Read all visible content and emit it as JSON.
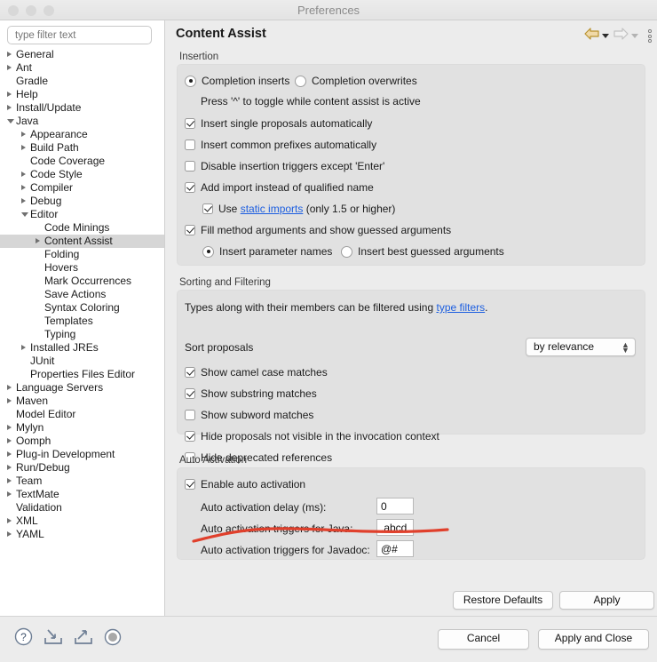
{
  "window": {
    "title": "Preferences"
  },
  "sidebar": {
    "filter_placeholder": "type filter text",
    "items": [
      {
        "label": "General",
        "depth": 0,
        "arrow": "closed"
      },
      {
        "label": "Ant",
        "depth": 0,
        "arrow": "closed"
      },
      {
        "label": "Gradle",
        "depth": 0,
        "arrow": "none"
      },
      {
        "label": "Help",
        "depth": 0,
        "arrow": "closed"
      },
      {
        "label": "Install/Update",
        "depth": 0,
        "arrow": "closed"
      },
      {
        "label": "Java",
        "depth": 0,
        "arrow": "open"
      },
      {
        "label": "Appearance",
        "depth": 1,
        "arrow": "closed"
      },
      {
        "label": "Build Path",
        "depth": 1,
        "arrow": "closed"
      },
      {
        "label": "Code Coverage",
        "depth": 1,
        "arrow": "none"
      },
      {
        "label": "Code Style",
        "depth": 1,
        "arrow": "closed"
      },
      {
        "label": "Compiler",
        "depth": 1,
        "arrow": "closed"
      },
      {
        "label": "Debug",
        "depth": 1,
        "arrow": "closed"
      },
      {
        "label": "Editor",
        "depth": 1,
        "arrow": "open"
      },
      {
        "label": "Code Minings",
        "depth": 2,
        "arrow": "none"
      },
      {
        "label": "Content Assist",
        "depth": 2,
        "arrow": "closed",
        "selected": true
      },
      {
        "label": "Folding",
        "depth": 2,
        "arrow": "none"
      },
      {
        "label": "Hovers",
        "depth": 2,
        "arrow": "none"
      },
      {
        "label": "Mark Occurrences",
        "depth": 2,
        "arrow": "none"
      },
      {
        "label": "Save Actions",
        "depth": 2,
        "arrow": "none"
      },
      {
        "label": "Syntax Coloring",
        "depth": 2,
        "arrow": "none"
      },
      {
        "label": "Templates",
        "depth": 2,
        "arrow": "none"
      },
      {
        "label": "Typing",
        "depth": 2,
        "arrow": "none"
      },
      {
        "label": "Installed JREs",
        "depth": 1,
        "arrow": "closed"
      },
      {
        "label": "JUnit",
        "depth": 1,
        "arrow": "none"
      },
      {
        "label": "Properties Files Editor",
        "depth": 1,
        "arrow": "none"
      },
      {
        "label": "Language Servers",
        "depth": 0,
        "arrow": "closed"
      },
      {
        "label": "Maven",
        "depth": 0,
        "arrow": "closed"
      },
      {
        "label": "Model Editor",
        "depth": 0,
        "arrow": "none"
      },
      {
        "label": "Mylyn",
        "depth": 0,
        "arrow": "closed"
      },
      {
        "label": "Oomph",
        "depth": 0,
        "arrow": "closed"
      },
      {
        "label": "Plug-in Development",
        "depth": 0,
        "arrow": "closed"
      },
      {
        "label": "Run/Debug",
        "depth": 0,
        "arrow": "closed"
      },
      {
        "label": "Team",
        "depth": 0,
        "arrow": "closed"
      },
      {
        "label": "TextMate",
        "depth": 0,
        "arrow": "closed"
      },
      {
        "label": "Validation",
        "depth": 0,
        "arrow": "none"
      },
      {
        "label": "XML",
        "depth": 0,
        "arrow": "closed"
      },
      {
        "label": "YAML",
        "depth": 0,
        "arrow": "closed"
      }
    ]
  },
  "page": {
    "title": "Content Assist",
    "nav": {
      "back_icon": "back-arrow-icon",
      "forward_icon": "forward-arrow-icon",
      "menu_icon": "view-menu-icon"
    }
  },
  "insertion": {
    "legend": "Insertion",
    "radio_inserts": "Completion inserts",
    "radio_overwrites": "Completion overwrites",
    "hint": "Press '^' to toggle while content assist is active",
    "cb_single": "Insert single proposals automatically",
    "cb_prefixes": "Insert common prefixes automatically",
    "cb_disable_triggers": "Disable insertion triggers except 'Enter'",
    "cb_add_import": "Add import instead of qualified name",
    "static_pre": "Use ",
    "static_link": "static imports",
    "static_post": " (only 1.5 or higher)",
    "cb_fill_args": "Fill method arguments and show guessed arguments",
    "radio_param_names": "Insert parameter names",
    "radio_best_guessed": "Insert best guessed arguments"
  },
  "sorting": {
    "legend": "Sorting and Filtering",
    "desc_pre": "Types along with their members can be filtered using ",
    "desc_link": "type filters",
    "desc_post": ".",
    "sort_label": "Sort proposals",
    "sort_value": "by relevance",
    "cb_camel": "Show camel case matches",
    "cb_substring": "Show substring matches",
    "cb_subword": "Show subword matches",
    "cb_hide_not_visible": "Hide proposals not visible in the invocation context",
    "cb_hide_deprecated": "Hide deprecated references"
  },
  "auto_activation": {
    "legend": "Auto Activation",
    "cb_enable": "Enable auto activation",
    "delay_label": "Auto activation delay (ms):",
    "delay_value": "0",
    "java_label": "Auto activation triggers for Java:",
    "java_value": ".abcd",
    "javadoc_label": "Auto activation triggers for Javadoc:",
    "javadoc_value": "@#"
  },
  "buttons": {
    "restore_defaults": "Restore Defaults",
    "apply": "Apply",
    "cancel": "Cancel",
    "apply_and_close": "Apply and Close"
  },
  "status_icons": {
    "help": "help-icon",
    "import": "import-icon",
    "export": "export-icon",
    "progress": "progress-icon"
  },
  "annotation": {
    "color": "#e0402c",
    "type": "hand-drawn-underline"
  }
}
